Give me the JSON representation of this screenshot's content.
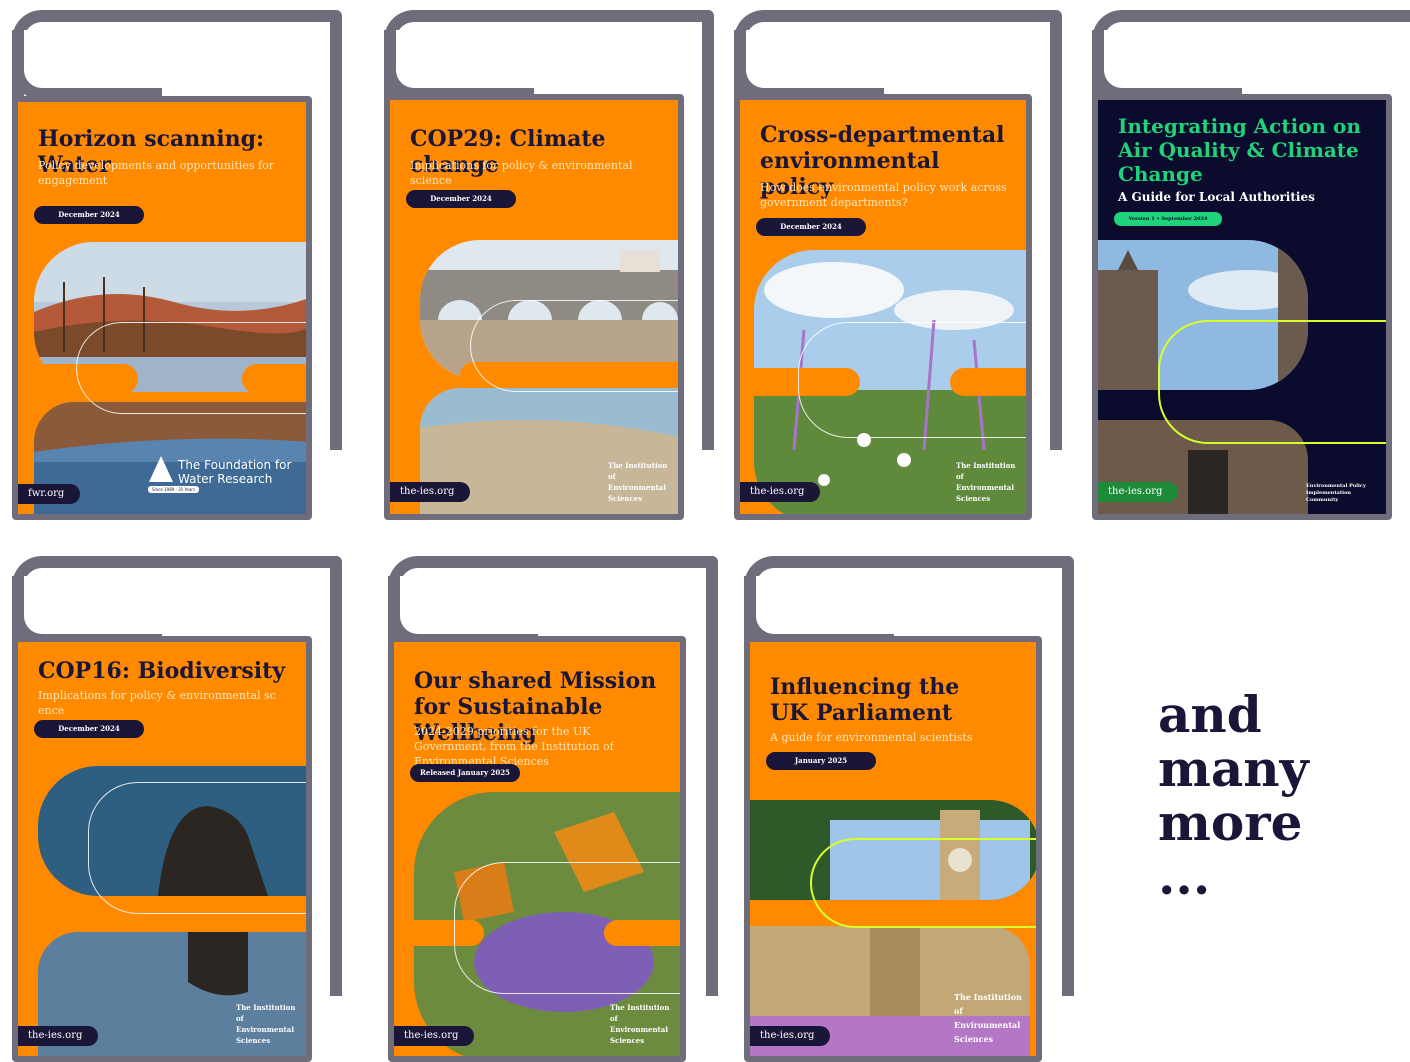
{
  "colors": {
    "orange": "#ff8a00",
    "navy": "#1a1637",
    "folder_gray": "#6f6d7c",
    "green": "#1ed37a"
  },
  "covers": [
    {
      "title": "Horizon scanning: Water",
      "subtitle": "Policy developments and opportunities for engagement",
      "date": "December 2024",
      "url": "fwr.org",
      "logo": "The Foundation for Water Research",
      "logo_tag": "Since 1989 · 35 Years"
    },
    {
      "title": "COP29: Climate change",
      "subtitle": "Implications for policy & environmental science",
      "date": "December 2024",
      "url": "the-ies.org",
      "logo": "The Institution of Environmental Sciences"
    },
    {
      "title": "Cross-departmental environmental policy",
      "subtitle": "How does environmental policy work across government departments?",
      "date": "December 2024",
      "url": "the-ies.org",
      "logo": "The Institution of Environmental Sciences"
    },
    {
      "title": "Integrating Action on Air Quality & Climate Change",
      "subtitle": "A Guide for Local Authorities",
      "date": "Version 1 • September 2024",
      "url": "the-ies.org",
      "logo": "Environmental Policy Implementation Community"
    },
    {
      "title": "COP16: Biodiversity",
      "subtitle": "Implications for policy & environmental sc ence",
      "date": "December 2024",
      "url": "the-ies.org",
      "logo": "The Institution of Environmental Sciences"
    },
    {
      "title": "Our shared Mission for Sustainable Wellbeing",
      "subtitle": "2024-2029 priorities for the UK Government, from the Institution of Environmental Sciences",
      "date": "Released January 2025",
      "url": "the-ies.org",
      "logo": "The Institution of Environmental Sciences"
    },
    {
      "title": "Influencing the UK Parliament",
      "subtitle": "A guide for environmental scientists",
      "date": "January 2025",
      "url": "the-ies.org",
      "logo": "The Institution of Environmental Sciences"
    }
  ],
  "more": {
    "line1": "and",
    "line2": "many",
    "line3": "more",
    "line4": "..."
  }
}
